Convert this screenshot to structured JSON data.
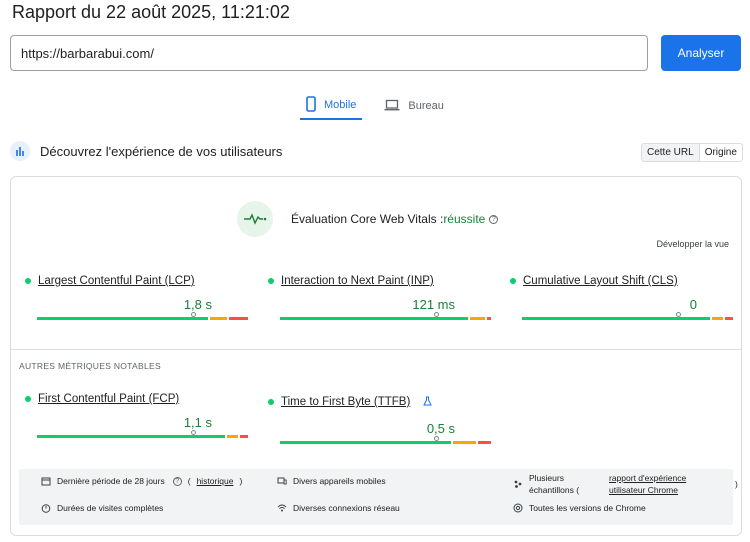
{
  "report_title": "Rapport du 22 août 2025, 11:21:02",
  "url_input": {
    "value": "https://barbarabui.com/"
  },
  "analyze_label": "Analyser",
  "tabs": [
    {
      "label": "Mobile",
      "icon": "smartphone-icon",
      "active": true
    },
    {
      "label": "Bureau",
      "icon": "laptop-icon",
      "active": false
    }
  ],
  "discover": {
    "text": "Découvrez l'expérience de vos utilisateurs",
    "icon": "users-icon"
  },
  "toggle": {
    "url": "Cette URL",
    "origin": "Origine"
  },
  "cwv": {
    "title": "Évaluation Core Web Vitals :",
    "status": "réussite",
    "expand": "Développer la vue"
  },
  "metrics": [
    {
      "name": "Largest Contentful Paint (LCP)",
      "value": "1,8 s",
      "marker": 0.74,
      "split": [
        0.82,
        0.91
      ]
    },
    {
      "name": "Interaction to Next Paint (INP)",
      "value": "121 ms",
      "marker": 0.74,
      "split": [
        0.9,
        0.98
      ]
    },
    {
      "name": "Cumulative Layout Shift (CLS)",
      "value": "0",
      "marker": 0.74,
      "split": [
        0.9,
        0.96
      ]
    }
  ],
  "other_title": "AUTRES MÉTRIQUES NOTABLES",
  "other_metrics": [
    {
      "name": "First Contentful Paint (FCP)",
      "value": "1,1 s",
      "marker": 0.74,
      "split": [
        0.9,
        0.96
      ]
    },
    {
      "name": "Time to First Byte (TTFB)",
      "value": "0,5 s",
      "marker": 0.74,
      "split": [
        0.82,
        0.94
      ]
    }
  ],
  "footer": {
    "period": "Dernière période de 28 jours",
    "history_link": "historique",
    "durations": "Durées de visites complètes",
    "devices": "Divers appareils mobiles",
    "networks": "Diverses connexions réseau",
    "samples_a": "Plusieurs",
    "samples_b": "échantillons (",
    "crux_link_a": "rapport d'expérience",
    "crux_link_b": "utilisateur Chrome",
    "paren_close": ")",
    "chrome": "Toutes les versions de Chrome"
  },
  "colors": {
    "accent": "#1a73e8",
    "good": "#0cce6b",
    "needs_improvement": "#ffa400",
    "poor": "#ff4e42"
  }
}
